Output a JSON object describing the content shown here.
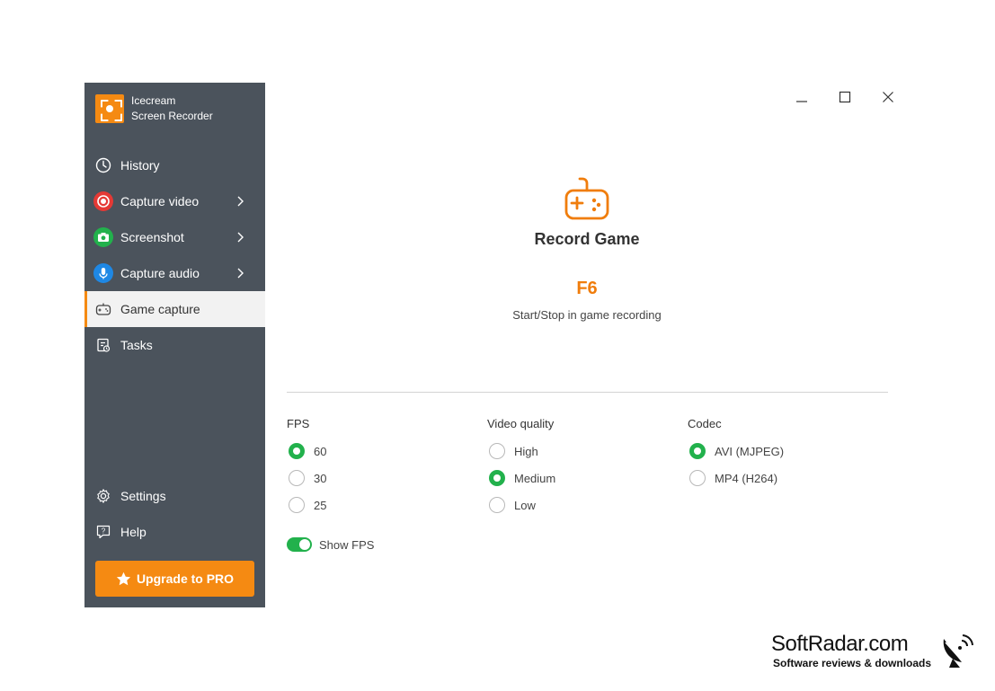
{
  "app": {
    "name_line1": "Icecream",
    "name_line2": "Screen Recorder"
  },
  "sidebar": {
    "items": [
      {
        "label": "History",
        "icon": "clock-icon"
      },
      {
        "label": "Capture video",
        "icon": "record-icon",
        "color": "#e53935"
      },
      {
        "label": "Screenshot",
        "icon": "camera-icon",
        "color": "#22b14c"
      },
      {
        "label": "Capture audio",
        "icon": "microphone-icon",
        "color": "#1e88e5"
      },
      {
        "label": "Game capture",
        "icon": "gamepad-icon",
        "active": true
      },
      {
        "label": "Tasks",
        "icon": "tasks-icon"
      }
    ],
    "bottom": [
      {
        "label": "Settings",
        "icon": "gear-icon"
      },
      {
        "label": "Help",
        "icon": "help-icon"
      }
    ],
    "upgrade_label": "Upgrade to PRO"
  },
  "main": {
    "title": "Record Game",
    "hotkey": "F6",
    "hotkey_desc": "Start/Stop in game recording"
  },
  "options": {
    "fps": {
      "label": "FPS",
      "choices": [
        "60",
        "30",
        "25"
      ],
      "selected": "60"
    },
    "quality": {
      "label": "Video quality",
      "choices": [
        "High",
        "Medium",
        "Low"
      ],
      "selected": "Medium"
    },
    "codec": {
      "label": "Codec",
      "choices": [
        "AVI (MJPEG)",
        "MP4 (H264)"
      ],
      "selected": "AVI (MJPEG)"
    },
    "show_fps": {
      "label": "Show FPS",
      "on": true
    }
  },
  "watermark": {
    "title": "SoftRadar.com",
    "subtitle": "Software reviews & downloads"
  },
  "colors": {
    "accent": "#f58a12",
    "sidebar_bg": "#4b535c",
    "selected": "#22b14c"
  }
}
